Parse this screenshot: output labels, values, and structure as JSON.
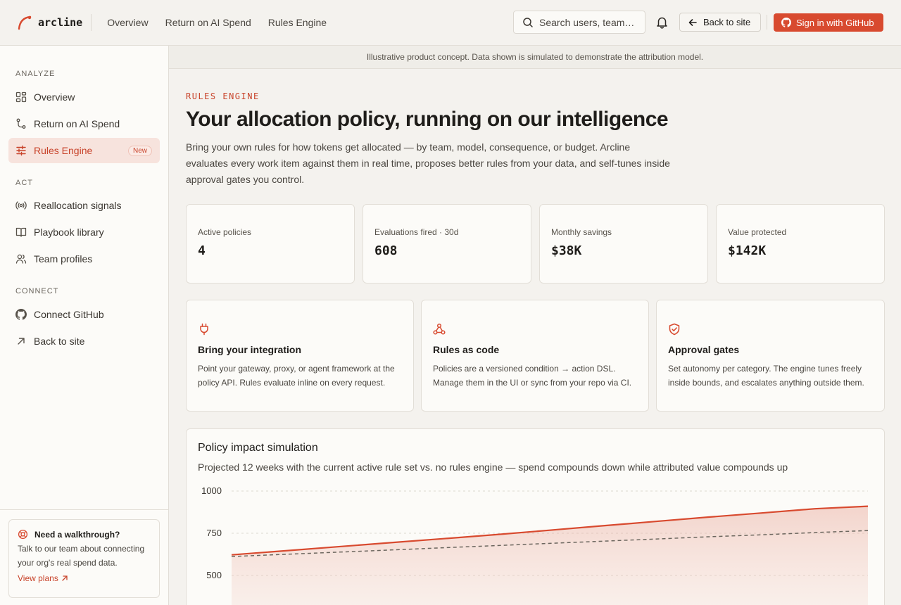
{
  "brand": {
    "name": "arcline"
  },
  "topnav": [
    "Overview",
    "Return on AI Spend",
    "Rules Engine"
  ],
  "search": {
    "placeholder": "Search users, teams…"
  },
  "header": {
    "back_label": "Back to site",
    "github_label": "Sign in with GitHub"
  },
  "sidebar": {
    "sections": [
      {
        "label": "ANALYZE",
        "items": [
          {
            "label": "Overview",
            "icon": "dashboard-icon"
          },
          {
            "label": "Return on AI Spend",
            "icon": "git-branch-icon"
          },
          {
            "label": "Rules Engine",
            "icon": "sliders-icon",
            "active": true,
            "badge": "New"
          }
        ]
      },
      {
        "label": "ACT",
        "items": [
          {
            "label": "Reallocation signals",
            "icon": "broadcast-icon"
          },
          {
            "label": "Playbook library",
            "icon": "book-icon"
          },
          {
            "label": "Team profiles",
            "icon": "users-icon"
          }
        ]
      },
      {
        "label": "CONNECT",
        "items": [
          {
            "label": "Connect GitHub",
            "icon": "github-icon"
          },
          {
            "label": "Back to site",
            "icon": "arrow-up-right-icon"
          }
        ]
      }
    ],
    "help": {
      "title": "Need a walkthrough?",
      "body": "Talk to our team about connecting your org's real spend data.",
      "link": "View plans"
    }
  },
  "banner": "Illustrative product concept. Data shown is simulated to demonstrate the attribution model.",
  "page": {
    "eyebrow": "RULES ENGINE",
    "title": "Your allocation policy, running on our intelligence",
    "lede": "Bring your own rules for how tokens get allocated — by team, model, consequence, or budget. Arcline evaluates every work item against them in real time, proposes better rules from your data, and self-tunes inside approval gates you control."
  },
  "stats": [
    {
      "label": "Active policies",
      "value": "4"
    },
    {
      "label": "Evaluations fired · 30d",
      "value": "608"
    },
    {
      "label": "Monthly savings",
      "value": "$38K"
    },
    {
      "label": "Value protected",
      "value": "$142K"
    }
  ],
  "features": [
    {
      "icon": "plug-icon",
      "title": "Bring your integration",
      "body": "Point your gateway, proxy, or agent framework at the policy API. Rules evaluate inline on every request."
    },
    {
      "icon": "webhook-icon",
      "title": "Rules as code",
      "body": "Policies are a versioned condition → action DSL. Manage them in the UI or sync from your repo via CI."
    },
    {
      "icon": "shield-check-icon",
      "title": "Approval gates",
      "body": "Set autonomy per category. The engine tunes freely inside bounds, and escalates anything outside them."
    }
  ],
  "colors": {
    "accent": "#d84a2f",
    "accent_text": "#c8432a"
  },
  "chart": {
    "title": "Policy impact simulation",
    "subtitle": "Projected 12 weeks with the current active rule set vs. no rules engine — spend compounds down while attributed value compounds up"
  },
  "chart_data": {
    "type": "area",
    "x": [
      0,
      1,
      2,
      3,
      4,
      5,
      6,
      7,
      8,
      9,
      10,
      11,
      12
    ],
    "yticks": [
      "1000",
      "750",
      "500"
    ],
    "ylim": [
      0,
      1000
    ],
    "grid": true,
    "series": [
      {
        "style": "solid-area",
        "values": [
          622,
          646,
          670,
          694,
          718,
          742,
          768,
          794,
          820,
          846,
          870,
          895,
          910
        ]
      },
      {
        "style": "dashed",
        "values": [
          612,
          625,
          638,
          651,
          664,
          677,
          690,
          703,
          716,
          729,
          741,
          754,
          766
        ]
      }
    ]
  }
}
